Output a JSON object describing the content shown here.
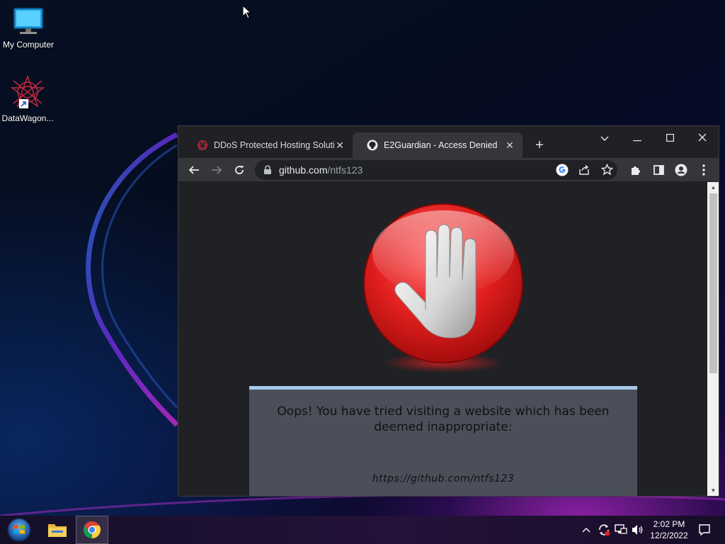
{
  "desktop": {
    "icons": [
      {
        "label": "My Computer",
        "icon": "monitor-icon"
      },
      {
        "label": "DataWagon...",
        "icon": "datawagon-shortcut-icon"
      }
    ]
  },
  "browser": {
    "tabs": [
      {
        "title": "DDoS Protected Hosting Solution",
        "icon": "datawagon-favicon",
        "active": false
      },
      {
        "title": "E2Guardian - Access Denied",
        "icon": "github-favicon",
        "active": true
      }
    ],
    "new_tab_label": "+",
    "address": {
      "host": "github.com",
      "path": "/ntfs123"
    }
  },
  "page": {
    "message": "Oops! You have tried visiting a website which has been deemed inappropriate:",
    "blocked_url": "https://github.com/ntfs123"
  },
  "taskbar": {
    "apps": [
      "start-button",
      "file-explorer",
      "google-chrome"
    ],
    "clock": {
      "time": "2:02 PM",
      "date": "12/2/2022"
    }
  },
  "colors": {
    "page_bg": "#202124",
    "stop_red": "#e01e1e",
    "message_box": "#4a4f5a",
    "message_border": "#a7c8e8"
  }
}
